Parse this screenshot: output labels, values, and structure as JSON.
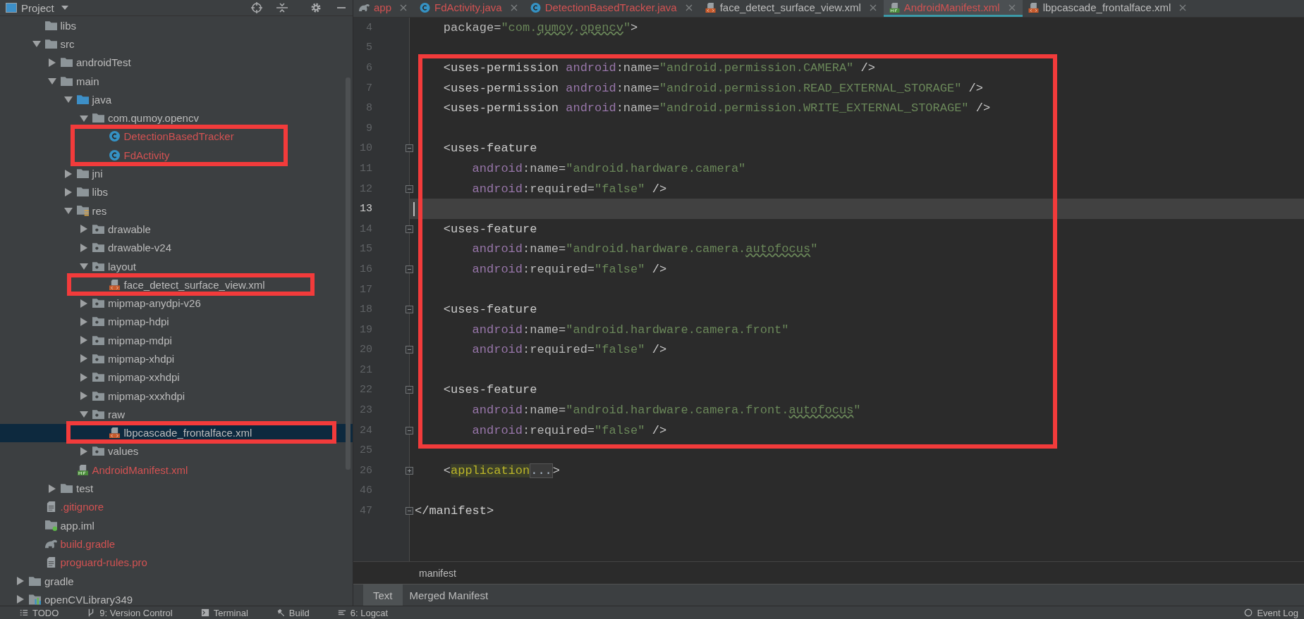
{
  "project_panel": {
    "title": "Project",
    "tree": [
      {
        "label": "libs",
        "kind": "folder",
        "selected": false,
        "unversioned": false
      },
      {
        "label": "src",
        "kind": "folder",
        "expanded": true,
        "selected": false,
        "unversioned": false,
        "children": [
          {
            "label": "androidTest",
            "kind": "folder",
            "expanded": false,
            "selected": false,
            "unversioned": false
          },
          {
            "label": "main",
            "kind": "folder",
            "expanded": true,
            "selected": false,
            "unversioned": false,
            "children": [
              {
                "label": "java",
                "kind": "source-folder",
                "expanded": true,
                "selected": false,
                "unversioned": false,
                "children": [
                  {
                    "label": "com.qumoy.opencv",
                    "kind": "folder",
                    "expanded": true,
                    "selected": false,
                    "unversioned": false,
                    "children": [
                      {
                        "label": "DetectionBasedTracker",
                        "kind": "class",
                        "selected": false,
                        "unversioned": true
                      },
                      {
                        "label": "FdActivity",
                        "kind": "class",
                        "selected": false,
                        "unversioned": true
                      }
                    ]
                  }
                ]
              },
              {
                "label": "jni",
                "kind": "folder",
                "expanded": false,
                "selected": false,
                "unversioned": false
              },
              {
                "label": "libs",
                "kind": "folder",
                "expanded": false,
                "selected": false,
                "unversioned": false
              },
              {
                "label": "res",
                "kind": "resource-folder",
                "expanded": true,
                "selected": false,
                "unversioned": false,
                "children": [
                  {
                    "label": "drawable",
                    "kind": "dot-folder",
                    "expanded": false,
                    "selected": false,
                    "unversioned": false
                  },
                  {
                    "label": "drawable-v24",
                    "kind": "dot-folder",
                    "expanded": false,
                    "selected": false,
                    "unversioned": false
                  },
                  {
                    "label": "layout",
                    "kind": "dot-folder",
                    "expanded": true,
                    "selected": false,
                    "unversioned": false,
                    "children": [
                      {
                        "label": "face_detect_surface_view.xml",
                        "kind": "xml",
                        "selected": false,
                        "unversioned": false
                      }
                    ]
                  },
                  {
                    "label": "mipmap-anydpi-v26",
                    "kind": "dot-folder",
                    "expanded": false,
                    "selected": false,
                    "unversioned": false
                  },
                  {
                    "label": "mipmap-hdpi",
                    "kind": "dot-folder",
                    "expanded": false,
                    "selected": false,
                    "unversioned": false
                  },
                  {
                    "label": "mipmap-mdpi",
                    "kind": "dot-folder",
                    "expanded": false,
                    "selected": false,
                    "unversioned": false
                  },
                  {
                    "label": "mipmap-xhdpi",
                    "kind": "dot-folder",
                    "expanded": false,
                    "selected": false,
                    "unversioned": false
                  },
                  {
                    "label": "mipmap-xxhdpi",
                    "kind": "dot-folder",
                    "expanded": false,
                    "selected": false,
                    "unversioned": false
                  },
                  {
                    "label": "mipmap-xxxhdpi",
                    "kind": "dot-folder",
                    "expanded": false,
                    "selected": false,
                    "unversioned": false
                  },
                  {
                    "label": "raw",
                    "kind": "dot-folder",
                    "expanded": true,
                    "selected": false,
                    "unversioned": false,
                    "children": [
                      {
                        "label": "lbpcascade_frontalface.xml",
                        "kind": "xml",
                        "selected": true,
                        "unversioned": false
                      }
                    ]
                  },
                  {
                    "label": "values",
                    "kind": "dot-folder",
                    "expanded": false,
                    "selected": false,
                    "unversioned": false
                  }
                ]
              },
              {
                "label": "AndroidManifest.xml",
                "kind": "manifest",
                "selected": false,
                "unversioned": true
              }
            ]
          },
          {
            "label": "test",
            "kind": "folder",
            "expanded": false,
            "selected": false,
            "unversioned": false
          }
        ]
      },
      {
        "label": ".gitignore",
        "kind": "text-file",
        "selected": false,
        "unversioned": true
      },
      {
        "label": "app.iml",
        "kind": "module-file",
        "selected": false,
        "unversioned": false
      },
      {
        "label": "build.gradle",
        "kind": "gradle",
        "selected": false,
        "unversioned": true
      },
      {
        "label": "proguard-rules.pro",
        "kind": "text-file",
        "selected": false,
        "unversioned": true
      }
    ],
    "outer_tree": [
      {
        "label": "gradle",
        "kind": "folder",
        "expanded": false,
        "selected": false,
        "unversioned": false
      },
      {
        "label": "openCVLibrary349",
        "kind": "library",
        "expanded": false,
        "selected": false,
        "unversioned": false
      }
    ]
  },
  "editor_tabs": [
    {
      "label": "app",
      "kind": "gradle",
      "selected": false,
      "unversioned": true
    },
    {
      "label": "FdActivity.java",
      "kind": "class",
      "selected": false,
      "unversioned": true
    },
    {
      "label": "DetectionBasedTracker.java",
      "kind": "class",
      "selected": false,
      "unversioned": true
    },
    {
      "label": "face_detect_surface_view.xml",
      "kind": "xml",
      "selected": false,
      "unversioned": false
    },
    {
      "label": "AndroidManifest.xml",
      "kind": "manifest",
      "selected": true,
      "unversioned": true
    },
    {
      "label": "lbpcascade_frontalface.xml",
      "kind": "xml",
      "selected": false,
      "unversioned": false
    }
  ],
  "code_lines": [
    {
      "number": "4",
      "kind": "plain",
      "current": false,
      "tokens": [
        {
          "kind": "attr",
          "text": "package="
        },
        {
          "kind": "value",
          "text": "\"com."
        },
        {
          "kind": "typo",
          "text": "qumoy"
        },
        {
          "kind": "value",
          "text": "."
        },
        {
          "kind": "typo",
          "text": "opencv"
        },
        {
          "kind": "value",
          "text": "\""
        },
        {
          "kind": "tag",
          "text": ">"
        }
      ]
    },
    {
      "number": "5",
      "kind": "plain",
      "current": false
    },
    {
      "number": "6",
      "kind": "plain",
      "current": false,
      "tokens": [
        {
          "kind": "tag",
          "text": "<uses-permission "
        },
        {
          "kind": "ns",
          "text": "android"
        },
        {
          "kind": "attr",
          "text": ":name="
        },
        {
          "kind": "value",
          "text": "\"android.permission.CAMERA\""
        },
        {
          "kind": "tag",
          "text": " />"
        }
      ]
    },
    {
      "number": "7",
      "kind": "plain",
      "current": false,
      "tokens": [
        {
          "kind": "tag",
          "text": "<uses-permission "
        },
        {
          "kind": "ns",
          "text": "android"
        },
        {
          "kind": "attr",
          "text": ":name="
        },
        {
          "kind": "value",
          "text": "\"android.permission.READ_EXTERNAL_STORAGE\""
        },
        {
          "kind": "tag",
          "text": " />"
        }
      ]
    },
    {
      "number": "8",
      "kind": "plain",
      "current": false,
      "tokens": [
        {
          "kind": "tag",
          "text": "<uses-permission "
        },
        {
          "kind": "ns",
          "text": "android"
        },
        {
          "kind": "attr",
          "text": ":name="
        },
        {
          "kind": "value",
          "text": "\"android.permission.WRITE_EXTERNAL_STORAGE\""
        },
        {
          "kind": "tag",
          "text": " />"
        }
      ]
    },
    {
      "number": "9",
      "kind": "plain",
      "current": false
    },
    {
      "number": "10",
      "kind": "fold-start",
      "current": false,
      "tokens": [
        {
          "kind": "tag",
          "text": "<uses-feature"
        }
      ],
      "children": [
        {
          "number": "11",
          "kind": "plain",
          "current": false,
          "tokens": [
            {
              "kind": "ns",
              "text": "android"
            },
            {
              "kind": "attr",
              "text": ":name="
            },
            {
              "kind": "value",
              "text": "\"android.hardware.camera\""
            }
          ]
        },
        {
          "number": "12",
          "kind": "fold-end",
          "current": false,
          "tokens": [
            {
              "kind": "ns",
              "text": "android"
            },
            {
              "kind": "attr",
              "text": ":required="
            },
            {
              "kind": "value",
              "text": "\"false\""
            },
            {
              "kind": "tag",
              "text": " />"
            }
          ]
        }
      ]
    },
    {
      "number": "13",
      "kind": "plain",
      "current": true
    },
    {
      "number": "14",
      "kind": "fold-start",
      "current": false,
      "tokens": [
        {
          "kind": "tag",
          "text": "<uses-feature"
        }
      ],
      "children": [
        {
          "number": "15",
          "kind": "plain",
          "current": false,
          "tokens": [
            {
              "kind": "ns",
              "text": "android"
            },
            {
              "kind": "attr",
              "text": ":name="
            },
            {
              "kind": "value",
              "text": "\"android.hardware.camera."
            },
            {
              "kind": "typo",
              "text": "autofocus"
            },
            {
              "kind": "value",
              "text": "\""
            }
          ]
        },
        {
          "number": "16",
          "kind": "fold-end",
          "current": false,
          "tokens": [
            {
              "kind": "ns",
              "text": "android"
            },
            {
              "kind": "attr",
              "text": ":required="
            },
            {
              "kind": "value",
              "text": "\"false\""
            },
            {
              "kind": "tag",
              "text": " />"
            }
          ]
        }
      ]
    },
    {
      "number": "17",
      "kind": "plain",
      "current": false
    },
    {
      "number": "18",
      "kind": "fold-start",
      "current": false,
      "tokens": [
        {
          "kind": "tag",
          "text": "<uses-feature"
        }
      ],
      "children": [
        {
          "number": "19",
          "kind": "plain",
          "current": false,
          "tokens": [
            {
              "kind": "ns",
              "text": "android"
            },
            {
              "kind": "attr",
              "text": ":name="
            },
            {
              "kind": "value",
              "text": "\"android.hardware.camera.front\""
            }
          ]
        },
        {
          "number": "20",
          "kind": "fold-end",
          "current": false,
          "tokens": [
            {
              "kind": "ns",
              "text": "android"
            },
            {
              "kind": "attr",
              "text": ":required="
            },
            {
              "kind": "value",
              "text": "\"false\""
            },
            {
              "kind": "tag",
              "text": " />"
            }
          ]
        }
      ]
    },
    {
      "number": "21",
      "kind": "plain",
      "current": false
    },
    {
      "number": "22",
      "kind": "fold-start",
      "current": false,
      "tokens": [
        {
          "kind": "tag",
          "text": "<uses-feature"
        }
      ],
      "children": [
        {
          "number": "23",
          "kind": "plain",
          "current": false,
          "tokens": [
            {
              "kind": "ns",
              "text": "android"
            },
            {
              "kind": "attr",
              "text": ":name="
            },
            {
              "kind": "value",
              "text": "\"android.hardware.camera.front."
            },
            {
              "kind": "typo",
              "text": "autofocus"
            },
            {
              "kind": "value",
              "text": "\""
            }
          ]
        },
        {
          "number": "24",
          "kind": "fold-end",
          "current": false,
          "tokens": [
            {
              "kind": "ns",
              "text": "android"
            },
            {
              "kind": "attr",
              "text": ":required="
            },
            {
              "kind": "value",
              "text": "\"false\""
            },
            {
              "kind": "tag",
              "text": " />"
            }
          ]
        }
      ]
    },
    {
      "number": "25",
      "kind": "plain",
      "current": false
    },
    {
      "number": "26",
      "kind": "folded",
      "current": false,
      "tokens": [
        {
          "kind": "tag",
          "text": "<"
        },
        {
          "kind": "highlight",
          "text": "application"
        },
        {
          "kind": "folded",
          "text": "..."
        },
        {
          "kind": "tag",
          "text": ">"
        }
      ]
    },
    {
      "number": "46",
      "kind": "plain",
      "current": false
    }
  ],
  "code_end_lines": [
    {
      "number": "47",
      "kind": "fold-end",
      "current": false,
      "tokens": [
        {
          "kind": "tag",
          "text": "</manifest>"
        }
      ]
    }
  ],
  "breadcrumb": "manifest",
  "view_tabs": [
    {
      "label": "Text",
      "selected": true
    },
    {
      "label": "Merged Manifest",
      "selected": false
    }
  ],
  "tool_window_bar": {
    "left": [
      {
        "label": "TODO",
        "kind": "list"
      },
      {
        "label": "9: Version Control",
        "kind": "vcs"
      },
      {
        "label": "Terminal",
        "kind": "terminal"
      },
      {
        "label": "Build",
        "kind": "hammer"
      },
      {
        "label": "6: Logcat",
        "kind": "logcat"
      }
    ],
    "right": [
      {
        "label": "Event Log",
        "kind": "event"
      }
    ]
  }
}
